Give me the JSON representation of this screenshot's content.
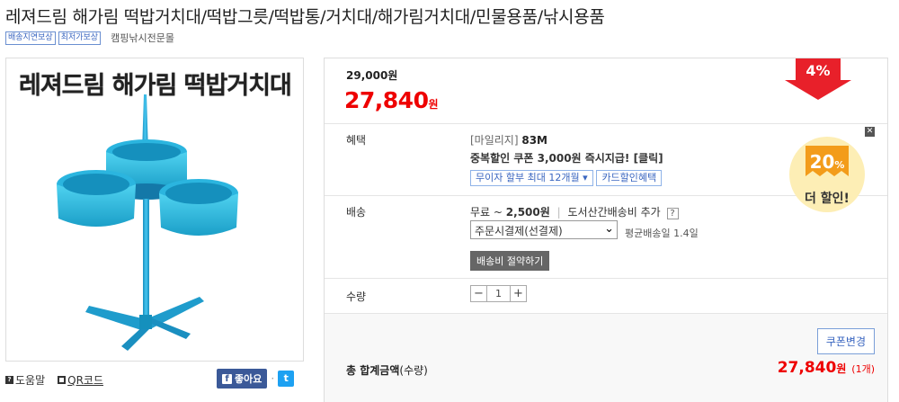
{
  "product": {
    "title": "레져드림 해가림 떡밥거치대/떡밥그릇/떡밥통/거치대/해가림거치대/민물용품/낚시용품",
    "badges": [
      "배송지연보상",
      "최저가보상"
    ],
    "seller": "캠핑낚시전문몰",
    "image_caption": "레져드림 해가림 떡밥거치대"
  },
  "util": {
    "help_icon": "question-box-icon",
    "help_label": "도움말",
    "qr_label": "QR코드",
    "like_label": "좋아요",
    "fb_icon": "f",
    "tw_icon": "t"
  },
  "price": {
    "original": "29,000원",
    "sale": "27,840",
    "won": "원",
    "discount_rate": "4%"
  },
  "benefit": {
    "label": "혜택",
    "mileage_label": "[마일리지]",
    "mileage_value": "83M",
    "coupon_text": "중복할인 쿠폰 3,000원 즉시지급! [클릭]",
    "installment_btn": "무이자 할부 최대 12개월",
    "card_btn": "카드할인혜택"
  },
  "shipping": {
    "label": "배송",
    "free_text": "무료 ~",
    "amount": "2,500원",
    "divider": "|",
    "island_text": "도서산간배송비 추가",
    "q_icon": "?",
    "select_value": "주문시결제(선결제)",
    "avg_text": "평균배송일 1.4일",
    "save_btn": "배송비 절약하기"
  },
  "quantity": {
    "label": "수량",
    "minus": "−",
    "value": "1",
    "plus": "+"
  },
  "total": {
    "coupon_change": "쿠폰변경",
    "label": "총 합계금액",
    "label_sub": "(수량)",
    "value": "27,840",
    "won": "원",
    "count": "(1개)"
  },
  "promo": {
    "percent": "20",
    "percent_sign": "%",
    "text": "더 할인!",
    "close": "✕"
  },
  "colors": {
    "accent_red": "#e00000",
    "badge_blue": "#3a66c0",
    "arrow_red": "#e8202a",
    "promo_orange": "#f39c1a"
  }
}
